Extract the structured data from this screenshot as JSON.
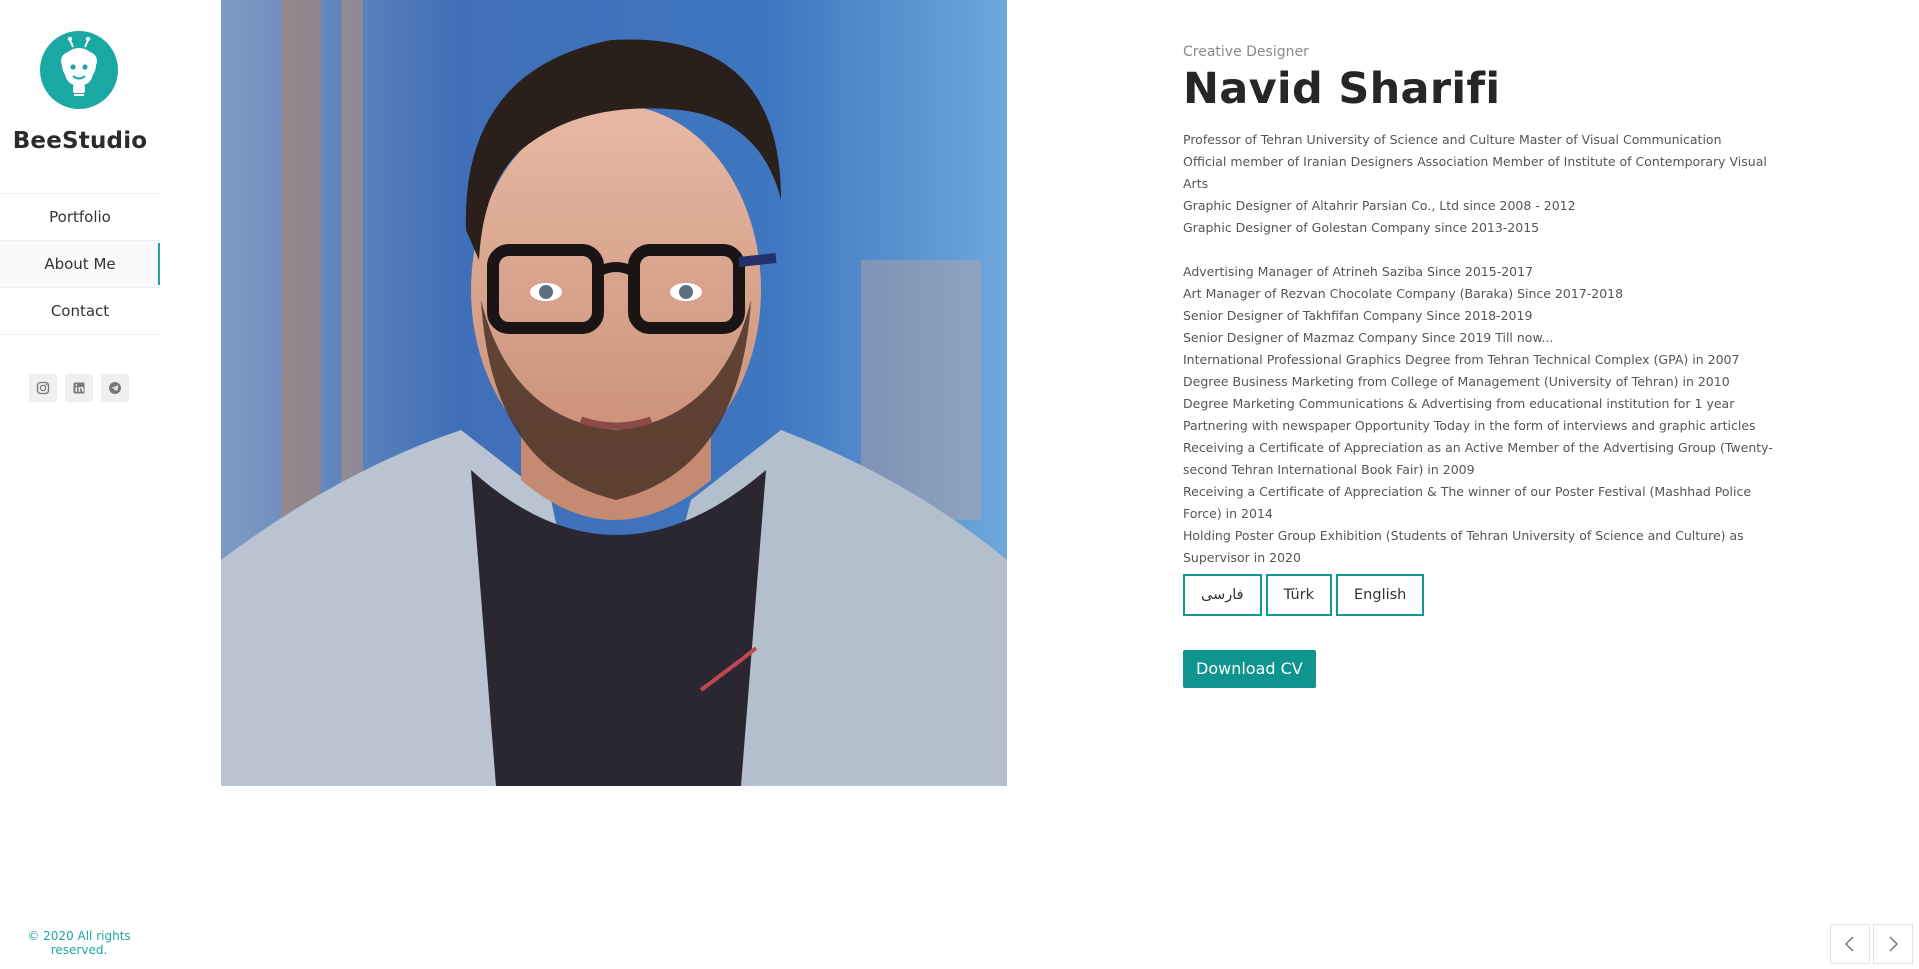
{
  "sidebar": {
    "brand": "BeeStudio",
    "nav": [
      {
        "label": "Portfolio"
      },
      {
        "label": "About Me"
      },
      {
        "label": "Contact"
      }
    ],
    "socials": [
      "instagram-icon",
      "linkedin-icon",
      "telegram-icon"
    ],
    "copyright": "© 2020 All rights reserved."
  },
  "profile": {
    "role": "Creative Designer",
    "name": "Navid Sharifi",
    "bio_group1": [
      "Professor of Tehran University of Science and Culture Master of Visual Communication",
      "Official member of Iranian Designers Association Member of Institute of Contemporary Visual Arts",
      "Graphic Designer of Altahrir Parsian Co., Ltd since 2008 - 2012",
      "Graphic Designer of Golestan Company since 2013-2015"
    ],
    "bio_group2": [
      "Advertising Manager of Atrineh Saziba Since 2015-2017",
      "Art Manager of Rezvan Chocolate Company (Baraka) Since 2017-2018",
      "Senior Designer of Takhfifan Company Since 2018-2019",
      "Senior Designer of Mazmaz Company Since 2019 Till now...",
      "International Professional Graphics Degree from Tehran Technical Complex (GPA) in 2007",
      "Degree Business Marketing from College of Management (University of Tehran) in 2010",
      "Degree Marketing Communications & Advertising from educational institution for 1 year",
      "Partnering with newspaper Opportunity Today in the form of interviews and graphic articles",
      "Receiving a Certificate of Appreciation as an Active Member of the Advertising Group (Twenty-second Tehran International Book Fair) in 2009",
      "Receiving a Certificate of Appreciation & The winner of our Poster Festival (Mashhad Police Force) in 2014",
      "Holding Poster Group Exhibition (Students of Tehran University of Science and Culture) as Supervisor in 2020"
    ],
    "languages": [
      "فارسی",
      "Türk",
      "English"
    ],
    "download_label": "Download CV"
  },
  "colors": {
    "accent": "#1aa8a4",
    "button": "#0f948f"
  }
}
